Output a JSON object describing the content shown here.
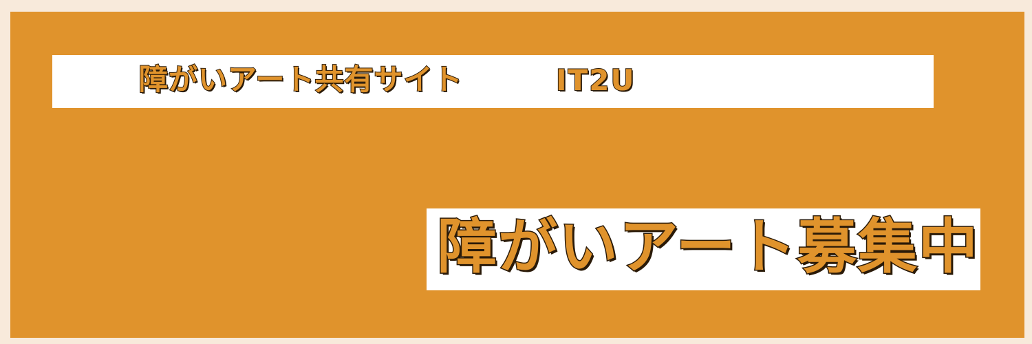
{
  "banner": {
    "site_name": "障がいアート共有サイト",
    "site_code": "IT2U",
    "headline": "障がいアート募集中"
  },
  "colors": {
    "background_outer": "#f8eadb",
    "background_panel": "#e0932c",
    "label_box": "#ffffff",
    "text_fill": "#e0932c",
    "text_outline": "#2a1a08"
  }
}
